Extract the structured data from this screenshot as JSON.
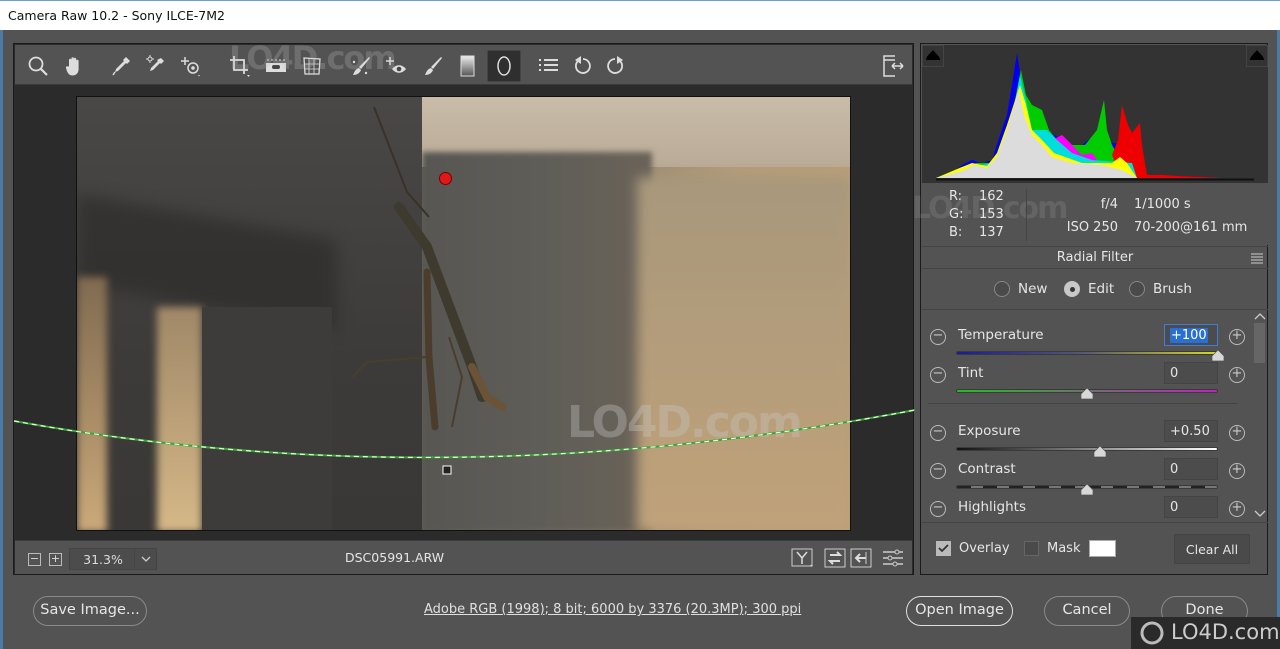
{
  "window": {
    "title": "Camera Raw 10.2  -  Sony ILCE-7M2"
  },
  "toolbar": {
    "tools": [
      {
        "name": "zoom-tool",
        "icon": "magnifier-icon"
      },
      {
        "name": "hand-tool",
        "icon": "hand-icon"
      },
      {
        "name": "white-balance-tool",
        "icon": "eyedropper-icon"
      },
      {
        "name": "color-sampler-tool",
        "icon": "color-sampler-icon"
      },
      {
        "name": "targeted-adjustment-tool",
        "icon": "target-adjust-icon"
      },
      {
        "name": "crop-tool",
        "icon": "crop-icon"
      },
      {
        "name": "straighten-tool",
        "icon": "level-icon"
      },
      {
        "name": "transform-tool",
        "icon": "transform-icon"
      },
      {
        "name": "spot-removal-tool",
        "icon": "spot-brush-icon"
      },
      {
        "name": "red-eye-tool",
        "icon": "red-eye-icon"
      },
      {
        "name": "adjustment-brush-tool",
        "icon": "brush-icon"
      },
      {
        "name": "graduated-filter-tool",
        "icon": "gradient-icon"
      },
      {
        "name": "radial-filter-tool",
        "icon": "ellipse-icon",
        "active": true
      },
      {
        "name": "preferences",
        "icon": "list-icon"
      },
      {
        "name": "rotate-left",
        "icon": "rotate-ccw-icon"
      },
      {
        "name": "rotate-right",
        "icon": "rotate-cw-icon"
      }
    ],
    "fullscreen_icon": "toggle-fullscreen-icon"
  },
  "preview": {
    "zoom_level": "31.3%",
    "filename": "DSC05991.ARW",
    "zoom_out_label": "−",
    "zoom_in_label": "+",
    "watermark": "LO4D.com"
  },
  "histogram": {
    "sample": {
      "r_label": "R:",
      "g_label": "G:",
      "b_label": "B:",
      "r": "162",
      "g": "153",
      "b": "137"
    },
    "exif": {
      "aperture": "f/4",
      "shutter": "1/1000 s",
      "iso": "ISO 250",
      "lens": "70-200@161 mm"
    }
  },
  "panel": {
    "title": "Radial Filter",
    "modes": [
      {
        "label": "New",
        "selected": false
      },
      {
        "label": "Edit",
        "selected": true
      },
      {
        "label": "Brush",
        "selected": false
      }
    ],
    "sliders": [
      {
        "label": "Temperature",
        "value": "+100",
        "position": 1.0,
        "selected": true,
        "gradient": "temperature"
      },
      {
        "label": "Tint",
        "value": "0",
        "position": 0.5,
        "gradient": "tint"
      },
      {
        "label": "Exposure",
        "value": "+0.50",
        "position": 0.55,
        "gradient": "exposure"
      },
      {
        "label": "Contrast",
        "value": "0",
        "position": 0.5,
        "gradient": "contrast"
      },
      {
        "label": "Highlights",
        "value": "0",
        "position": 0.5,
        "gradient": "highlights"
      }
    ],
    "footer": {
      "overlay_label": "Overlay",
      "overlay_checked": true,
      "mask_label": "Mask",
      "mask_checked": false,
      "mask_color": "#ffffff",
      "clear_all_label": "Clear All"
    }
  },
  "bottom": {
    "save_label": "Save Image...",
    "workflow_info": "Adobe RGB (1998); 8 bit; 6000 by 3376 (20.3MP); 300 ppi",
    "open_label": "Open Image",
    "cancel_label": "Cancel",
    "done_label": "Done"
  },
  "watermark": {
    "text": "LO4D.com"
  }
}
